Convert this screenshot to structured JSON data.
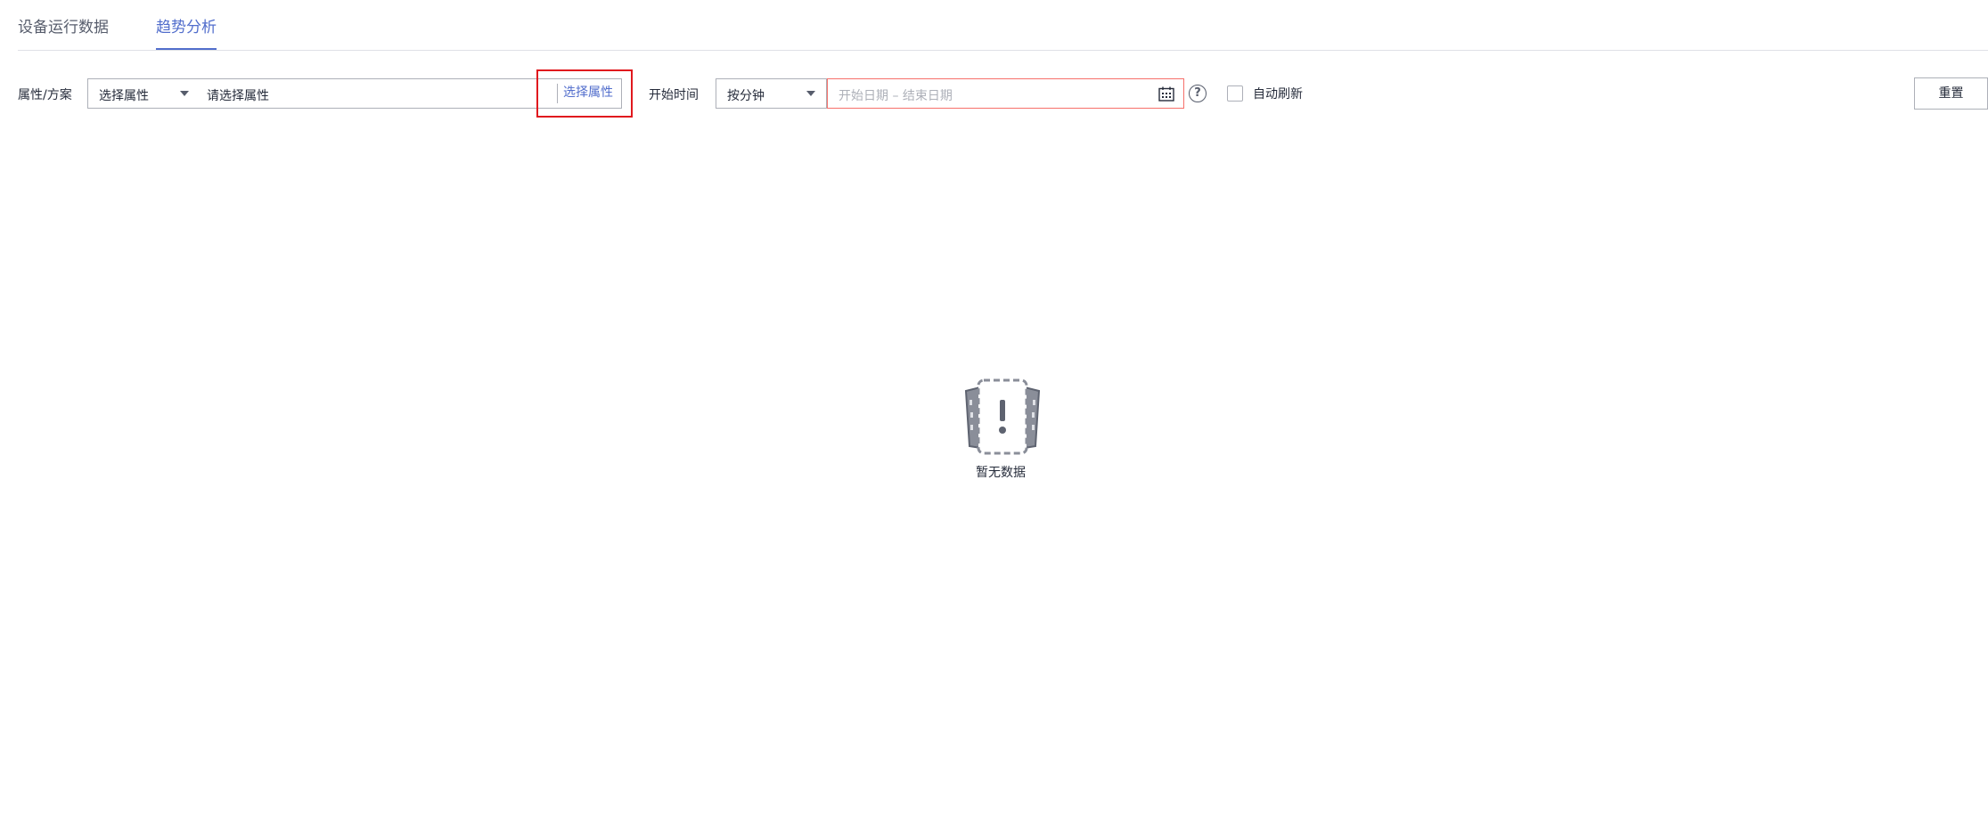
{
  "tabs": [
    {
      "label": "设备运行数据",
      "active": false
    },
    {
      "label": "趋势分析",
      "active": true
    }
  ],
  "filters": {
    "attr_label": "属性/方案",
    "attr_select_value": "选择属性",
    "attr_input_placeholder": "请选择属性",
    "attr_pick_button": "选择属性",
    "start_time_label": "开始时间",
    "granularity_value": "按分钟",
    "date_range_placeholder": "开始日期 – 结束日期",
    "help_symbol": "?",
    "auto_refresh_label": "自动刷新",
    "auto_refresh_checked": false,
    "reset_button": "重置"
  },
  "empty_state": {
    "text": "暂无数据",
    "icon": "no-data-icon"
  },
  "colors": {
    "accent": "#526ecc",
    "highlight_red": "#e0191e",
    "error_border": "#f66f6a"
  }
}
